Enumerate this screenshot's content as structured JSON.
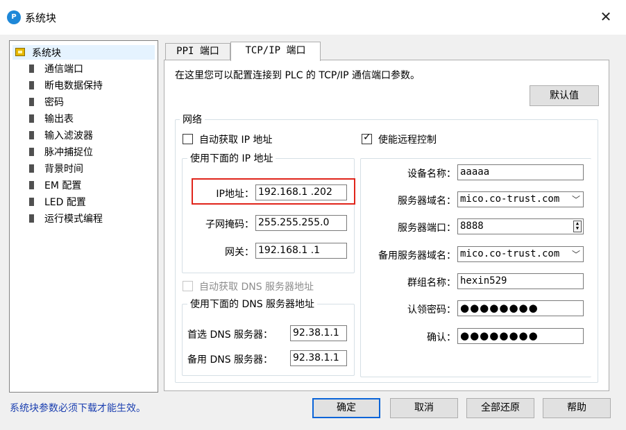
{
  "window": {
    "title": "系统块",
    "app_icon": "app-logo",
    "close_symbol": "✕"
  },
  "tree": {
    "root": "系统块",
    "items": [
      "通信端口",
      "断电数据保持",
      "密码",
      "输出表",
      "输入滤波器",
      "脉冲捕捉位",
      "背景时间",
      "EM 配置",
      "LED 配置",
      "运行模式编程"
    ]
  },
  "tabs": [
    {
      "label": "PPI 端口",
      "selected": false
    },
    {
      "label": "TCP/IP 端口",
      "selected": true
    }
  ],
  "panel": {
    "description": "在这里您可以配置连接到 PLC 的 TCP/IP 通信端口参数。",
    "default_button": "默认值",
    "network_group": "网络",
    "auto_ip": {
      "label": "自动获取 IP 地址",
      "checked": false
    },
    "manual_ip_group": "使用下面的 IP 地址",
    "ip_label": "IP地址：",
    "ip_value": "192.168.1  .202",
    "subnet_label": "子网掩码：",
    "subnet_value": "255.255.255.0",
    "gateway_label": "网关：",
    "gateway_value": "192.168.1  .1",
    "auto_dns": {
      "label": "自动获取 DNS 服务器地址",
      "checked": false,
      "disabled": true
    },
    "manual_dns_group": "使用下面的 DNS 服务器地址",
    "dns_primary_label": "首选 DNS 服务器：",
    "dns_primary_value": "92.38.1.1",
    "dns_alt_label": "备用 DNS 服务器：",
    "dns_alt_value": "92.38.1.1",
    "remote_control": {
      "label": "使能远程控制",
      "checked": true
    },
    "device_name_label": "设备名称：",
    "device_name_value": "aaaaa",
    "server_domain_label": "服务器域名：",
    "server_domain_value": "mico.co-trust.com",
    "server_port_label": "服务器端口：",
    "server_port_value": "8888",
    "backup_domain_label": "备用服务器域名：",
    "backup_domain_value": "mico.co-trust.com",
    "group_name_label": "群组名称：",
    "group_name_value": "hexin529",
    "claim_password_label": "认领密码：",
    "claim_password_value": "●●●●●●●●",
    "confirm_label": "确认：",
    "confirm_value": "●●●●●●●●"
  },
  "footer": {
    "note": "系统块参数必须下载才能生效。",
    "ok": "确定",
    "cancel": "取消",
    "restore_all": "全部还原",
    "help": "帮助"
  },
  "colors": {
    "highlight_box": "#e0241a",
    "note_text": "#1b3fb0",
    "ok_border": "#0a64d8"
  }
}
